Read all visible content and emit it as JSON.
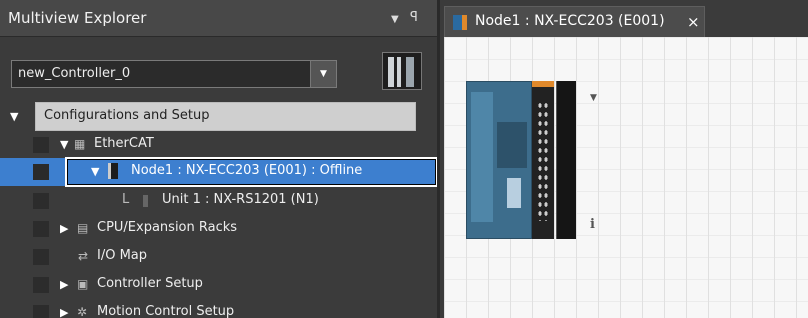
{
  "panel": {
    "title": "Multiview Explorer",
    "dropdown_glyph": "▼",
    "pin_glyph": "ꟼ"
  },
  "controller_select": {
    "value": "new_Controller_0",
    "arrow": "▼"
  },
  "tree": {
    "root": {
      "label": "Configurations and Setup",
      "expander": "▼"
    },
    "items": [
      {
        "label": "EtherCAT",
        "expander": "▼",
        "icon": "ethercat-icon"
      },
      {
        "label": "Node1 : NX-ECC203 (E001) : Offline",
        "expander": "▼",
        "icon": "node-icon",
        "selected": true
      },
      {
        "label": "Unit 1 : NX-RS1201 (N1)",
        "expander": "L",
        "icon": "unit-icon"
      },
      {
        "label": "CPU/Expansion Racks",
        "expander": "▶",
        "icon": "rack-icon"
      },
      {
        "label": "I/O Map",
        "expander": "",
        "icon": "io-map-icon"
      },
      {
        "label": "Controller Setup",
        "expander": "▶",
        "icon": "controller-setup-icon"
      },
      {
        "label": "Motion Control Setup",
        "expander": "▶",
        "icon": "motion-icon"
      }
    ]
  },
  "editor": {
    "tab_label": "Node1 : NX-ECC203 (E001)",
    "tab_close": "×",
    "device_menu_glyph": "▼",
    "device_info_glyph": "i"
  },
  "colors": {
    "selection": "#3d7fcf",
    "panel_bg": "#3b3b3b",
    "canvas_bg": "#f7f7f7"
  }
}
